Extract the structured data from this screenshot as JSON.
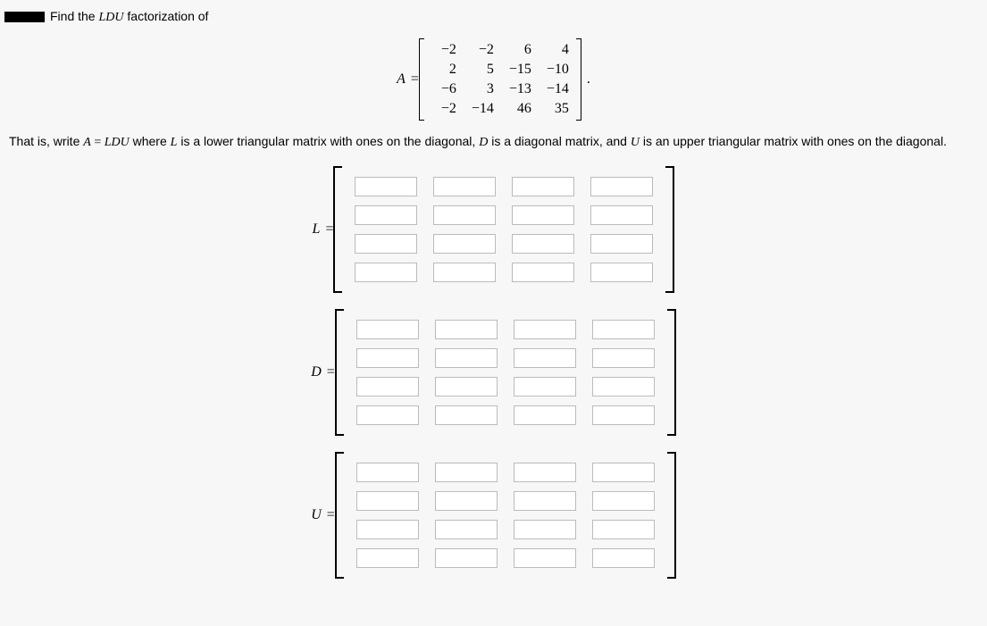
{
  "header": {
    "prompt_prefix": "Find the ",
    "ldu": "LDU",
    "prompt_suffix": " factorization of"
  },
  "A": {
    "label": "A",
    "eq": " = ",
    "rows": [
      [
        "−2",
        "−2",
        "6",
        "4"
      ],
      [
        "2",
        "5",
        "−15",
        "−10"
      ],
      [
        "−6",
        "3",
        "−13",
        "−14"
      ],
      [
        "−2",
        "−14",
        "46",
        "35"
      ]
    ],
    "period": "."
  },
  "desc": {
    "t1": "That is, write ",
    "A": "A",
    "eq": " = ",
    "LDU": "LDU",
    "t2": " where ",
    "L": "L",
    "t3": " is a lower triangular matrix with ones on the diagonal, ",
    "D": "D",
    "t4": " is a diagonal matrix, and ",
    "U": "U",
    "t5": " is an upper triangular matrix with ones on the diagonal."
  },
  "matrices": {
    "L": {
      "label": "L",
      "eq": " = "
    },
    "D": {
      "label": "D",
      "eq": " = "
    },
    "U": {
      "label": "U",
      "eq": " = "
    }
  }
}
